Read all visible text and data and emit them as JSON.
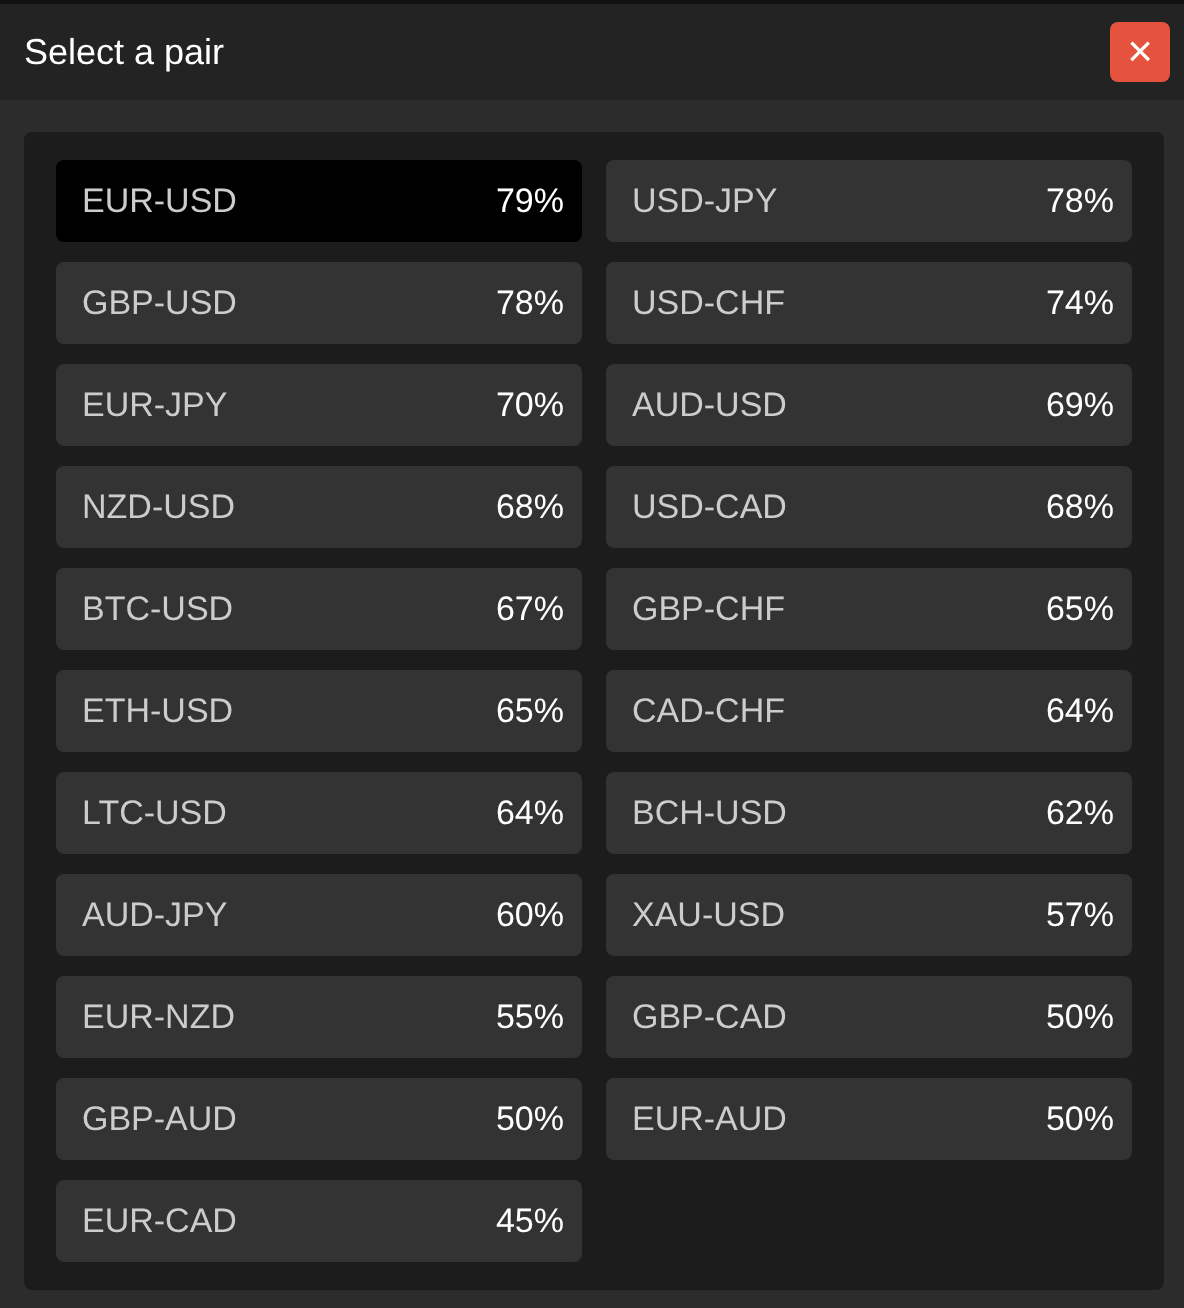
{
  "dialog": {
    "title": "Select a pair",
    "close": "×"
  },
  "pairs": [
    {
      "name": "EUR-USD",
      "payout": "79%",
      "selected": true
    },
    {
      "name": "USD-JPY",
      "payout": "78%",
      "selected": false
    },
    {
      "name": "GBP-USD",
      "payout": "78%",
      "selected": false
    },
    {
      "name": "USD-CHF",
      "payout": "74%",
      "selected": false
    },
    {
      "name": "EUR-JPY",
      "payout": "70%",
      "selected": false
    },
    {
      "name": "AUD-USD",
      "payout": "69%",
      "selected": false
    },
    {
      "name": "NZD-USD",
      "payout": "68%",
      "selected": false
    },
    {
      "name": "USD-CAD",
      "payout": "68%",
      "selected": false
    },
    {
      "name": "BTC-USD",
      "payout": "67%",
      "selected": false
    },
    {
      "name": "GBP-CHF",
      "payout": "65%",
      "selected": false
    },
    {
      "name": "ETH-USD",
      "payout": "65%",
      "selected": false
    },
    {
      "name": "CAD-CHF",
      "payout": "64%",
      "selected": false
    },
    {
      "name": "LTC-USD",
      "payout": "64%",
      "selected": false
    },
    {
      "name": "BCH-USD",
      "payout": "62%",
      "selected": false
    },
    {
      "name": "AUD-JPY",
      "payout": "60%",
      "selected": false
    },
    {
      "name": "XAU-USD",
      "payout": "57%",
      "selected": false
    },
    {
      "name": "EUR-NZD",
      "payout": "55%",
      "selected": false
    },
    {
      "name": "GBP-CAD",
      "payout": "50%",
      "selected": false
    },
    {
      "name": "GBP-AUD",
      "payout": "50%",
      "selected": false
    },
    {
      "name": "EUR-AUD",
      "payout": "50%",
      "selected": false
    },
    {
      "name": "EUR-CAD",
      "payout": "45%",
      "selected": false
    }
  ]
}
